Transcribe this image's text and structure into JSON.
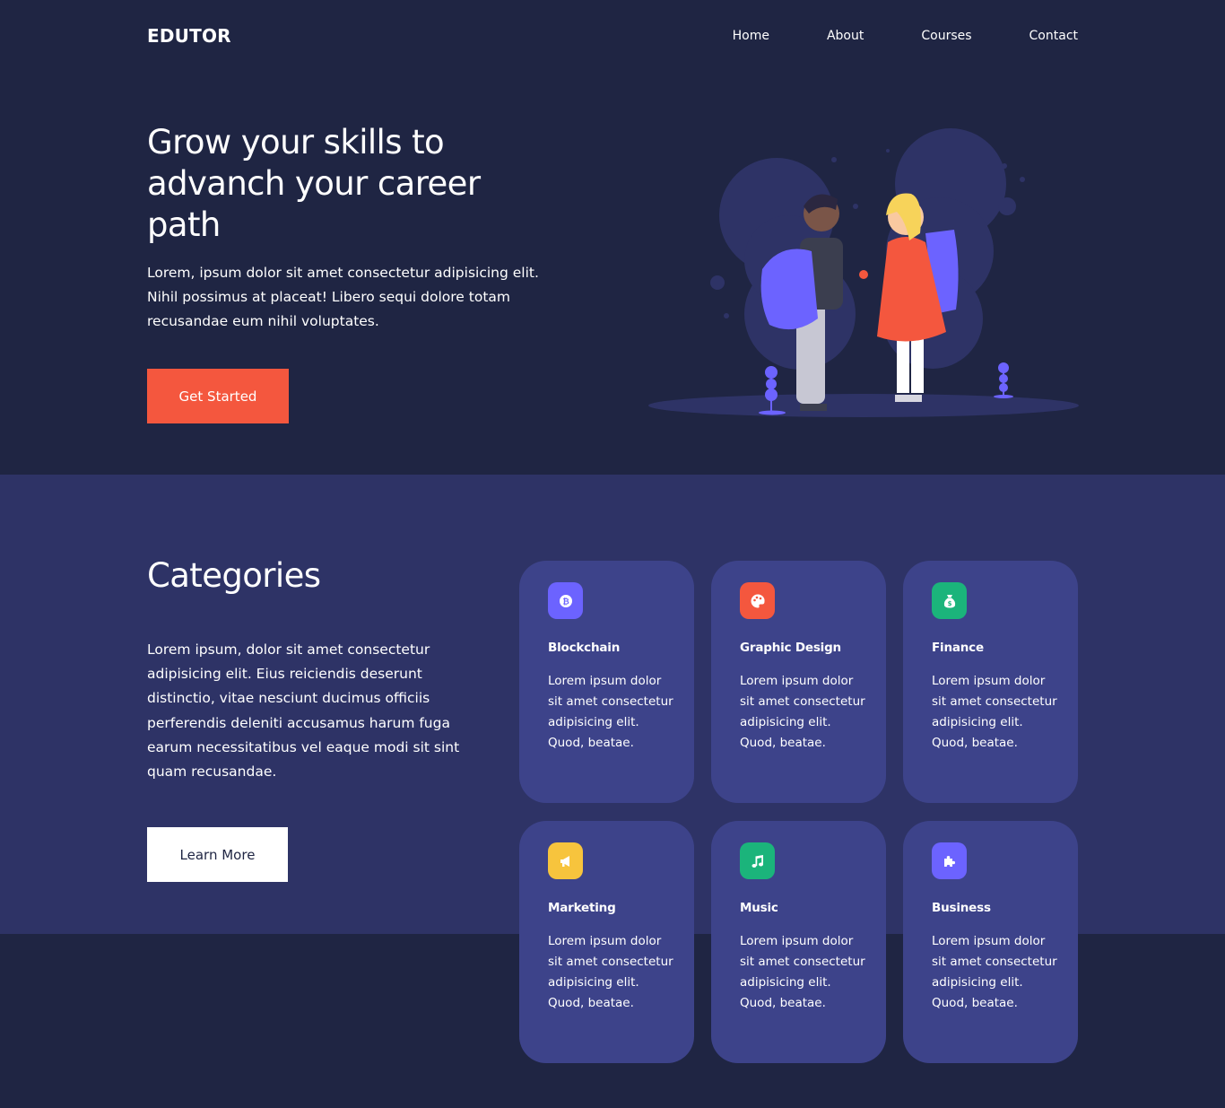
{
  "header": {
    "logo": "EDUTOR",
    "nav": [
      "Home",
      "About",
      "Courses",
      "Contact"
    ]
  },
  "hero": {
    "title": "Grow your skills to advanch your career path",
    "text": "Lorem, ipsum dolor sit amet consectetur adipisicing elit. Nihil possimus at placeat! Libero sequi dolore totam recusandae eum nihil voluptates.",
    "button": "Get Started"
  },
  "categories": {
    "title": "Categories",
    "text": "Lorem ipsum, dolor sit amet consectetur adipisicing elit. Eius reiciendis deserunt distinctio, vitae nesciunt ducimus officiis perferendis deleniti accusamus harum fuga earum necessitatibus vel eaque modi sit sint quam recusandae.",
    "button": "Learn More",
    "cards": [
      {
        "title": "Blockchain",
        "text": "Lorem ipsum dolor sit amet consectetur adipisicing elit. Quod, beatae.",
        "icon": "bitcoin-icon",
        "color": "#6c63ff"
      },
      {
        "title": "Graphic Design",
        "text": "Lorem ipsum dolor sit amet consectetur adipisicing elit. Quod, beatae.",
        "icon": "palette-icon",
        "color": "#f4573e"
      },
      {
        "title": "Finance",
        "text": "Lorem ipsum dolor sit amet consectetur adipisicing elit. Quod, beatae.",
        "icon": "money-bag-icon",
        "color": "#1bb47b"
      },
      {
        "title": "Marketing",
        "text": "Lorem ipsum dolor sit amet consectetur adipisicing elit. Quod, beatae.",
        "icon": "megaphone-icon",
        "color": "#f7c43d"
      },
      {
        "title": "Music",
        "text": "Lorem ipsum dolor sit amet consectetur adipisicing elit. Quod, beatae.",
        "icon": "music-note-icon",
        "color": "#1bb47b"
      },
      {
        "title": "Business",
        "text": "Lorem ipsum dolor sit amet consectetur adipisicing elit. Quod, beatae.",
        "icon": "puzzle-icon",
        "color": "#6c63ff"
      }
    ]
  },
  "colors": {
    "background": "#1f2543",
    "band": "#2e3366",
    "card": "#3d438a",
    "accent": "#f4573e"
  }
}
